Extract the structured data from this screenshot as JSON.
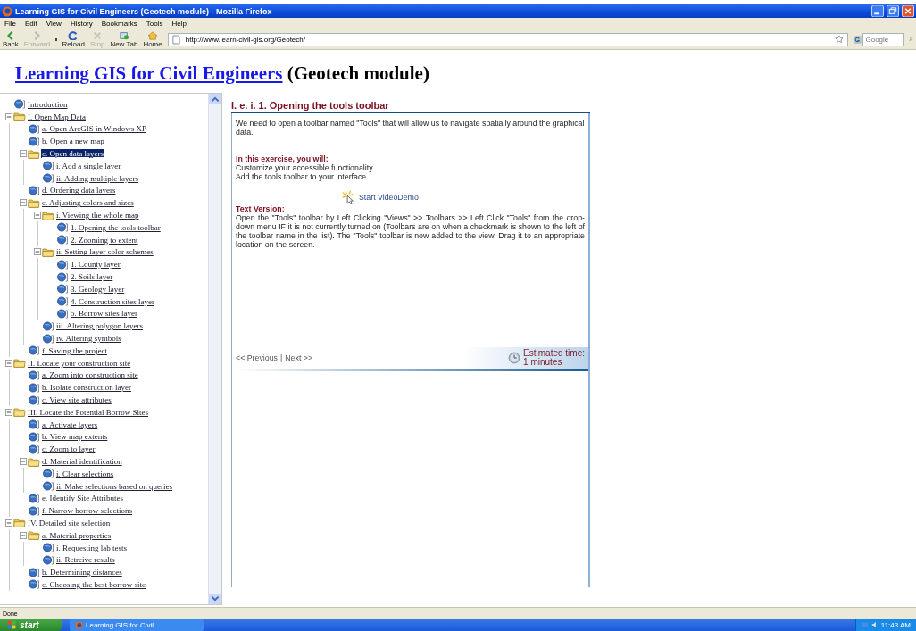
{
  "window": {
    "title": "Learning GIS for Civil Engineers (Geotech module) - Mozilla Firefox"
  },
  "menu": [
    "File",
    "Edit",
    "View",
    "History",
    "Bookmarks",
    "Tools",
    "Help"
  ],
  "toolbar": [
    {
      "kind": "back",
      "label": "Back",
      "disabled": false
    },
    {
      "kind": "forward",
      "label": "Forward",
      "disabled": true
    },
    {
      "kind": "reload",
      "label": "Reload",
      "disabled": false
    },
    {
      "kind": "stop",
      "label": "Stop",
      "disabled": true
    },
    {
      "kind": "newtab",
      "label": "New Tab",
      "disabled": false
    },
    {
      "kind": "home",
      "label": "Home",
      "disabled": false
    }
  ],
  "address": {
    "value": "http://www.learn-civil-gis.org/Geotech/"
  },
  "search": {
    "placeholder": "Google"
  },
  "heading": {
    "link": "Learning GIS for Civil Engineers",
    "rest": "(Geotech module)"
  },
  "tree": [
    {
      "kind": "page",
      "label": "Introduction",
      "selected": false
    },
    {
      "kind": "folder",
      "label": "I. Open Map Data",
      "expanded": true,
      "selected": false,
      "children": [
        {
          "kind": "page",
          "label": "a. Open ArcGIS in Windows XP",
          "selected": false
        },
        {
          "kind": "page",
          "label": "b. Open a new map",
          "selected": false
        },
        {
          "kind": "folder",
          "label": "c. Open data layers",
          "expanded": true,
          "selected": true,
          "children": [
            {
              "kind": "page",
              "label": "i. Add a single layer",
              "selected": false
            },
            {
              "kind": "page",
              "label": "ii. Adding multiple layers",
              "selected": false
            }
          ]
        },
        {
          "kind": "page",
          "label": "d. Ordering data layers",
          "selected": false
        },
        {
          "kind": "folder",
          "label": "e. Adjusting colors and sizes",
          "expanded": true,
          "selected": false,
          "children": [
            {
              "kind": "folder",
              "label": "i. Viewing the whole map",
              "expanded": true,
              "selected": false,
              "children": [
                {
                  "kind": "page",
                  "label": "1. Opening the tools toolbar",
                  "selected": false
                },
                {
                  "kind": "page",
                  "label": "2. Zooming to extent",
                  "selected": false
                }
              ]
            },
            {
              "kind": "folder",
              "label": "ii. Setting layer color schemes",
              "expanded": true,
              "selected": false,
              "children": [
                {
                  "kind": "page",
                  "label": "1. County layer",
                  "selected": false
                },
                {
                  "kind": "page",
                  "label": "2. Soils layer",
                  "selected": false
                },
                {
                  "kind": "page",
                  "label": "3. Geology layer",
                  "selected": false
                },
                {
                  "kind": "page",
                  "label": "4. Construction sites layer",
                  "selected": false
                },
                {
                  "kind": "page",
                  "label": "5. Borrow sites layer",
                  "selected": false
                }
              ]
            },
            {
              "kind": "page",
              "label": "iii. Altering polygon layers",
              "selected": false
            },
            {
              "kind": "page",
              "label": "iv. Altering symbols",
              "selected": false
            }
          ]
        },
        {
          "kind": "page",
          "label": "f. Saving the project",
          "selected": false
        }
      ]
    },
    {
      "kind": "folder",
      "label": "II. Locate your construction site",
      "expanded": true,
      "selected": false,
      "children": [
        {
          "kind": "page",
          "label": "a. Zoom into construction site",
          "selected": false
        },
        {
          "kind": "page",
          "label": "b. Isolate construction layer",
          "selected": false
        },
        {
          "kind": "page",
          "label": "c. View site attributes",
          "selected": false
        }
      ]
    },
    {
      "kind": "folder",
      "label": "III. Locate the Potential Borrow Sites",
      "expanded": true,
      "selected": false,
      "children": [
        {
          "kind": "page",
          "label": "a. Activate layers",
          "selected": false
        },
        {
          "kind": "page",
          "label": "b. View map extents",
          "selected": false
        },
        {
          "kind": "page",
          "label": "c. Zoom to layer",
          "selected": false
        },
        {
          "kind": "folder",
          "label": "d. Material identification",
          "expanded": true,
          "selected": false,
          "children": [
            {
              "kind": "page",
              "label": "i. Clear selections",
              "selected": false
            },
            {
              "kind": "page",
              "label": "ii. Make selections based on queries",
              "selected": false
            }
          ]
        },
        {
          "kind": "page",
          "label": "e. Identify Site Attributes",
          "selected": false
        },
        {
          "kind": "page",
          "label": "f. Narrow borrow selections",
          "selected": false
        }
      ]
    },
    {
      "kind": "folder",
      "label": "IV. Detailed site selection",
      "expanded": true,
      "selected": false,
      "children": [
        {
          "kind": "folder",
          "label": "a. Material properties",
          "expanded": true,
          "selected": false,
          "children": [
            {
              "kind": "page",
              "label": "i. Requesting lab tests",
              "selected": false
            },
            {
              "kind": "page",
              "label": "ii. Retreive results",
              "selected": false
            }
          ]
        },
        {
          "kind": "page",
          "label": "b. Determining distances",
          "selected": false
        },
        {
          "kind": "page",
          "label": "c. Choosing the best borrow site",
          "selected": false
        }
      ]
    }
  ],
  "lesson": {
    "title": "I. e. i. 1. Opening the tools toolbar",
    "intro": "We need to open a toolbar named \"Tools\" that will allow us to navigate spatially around the graphical data.",
    "exercise_heading": "In this exercise, you will:",
    "exercise_items": [
      "Customize your accessible functionality.",
      "Add the tools toolbar to your interface."
    ],
    "video_link": "Start VideoDemo",
    "text_heading": "Text Version:",
    "text": "Open the \"Tools\" toolbar by Left Clicking \"Views\" >> Toolbars >> Left Click \"Tools\" from the drop-down menu IF it is not currently turned on (Toolbars are on when a checkmark is shown to the left of the toolbar name in the list). The \"Tools\" toolbar is now added to the view. Drag it to an appropriate location on the screen.",
    "previous": "<< Previous",
    "separator": "|",
    "next": "Next >>",
    "time_label": "Estimated time:",
    "time_value": "1 minutes"
  },
  "status_bar": "Done",
  "taskbar": {
    "start": "start",
    "task": "Learning GIS for Civil ...",
    "clock": "11:43 AM"
  }
}
